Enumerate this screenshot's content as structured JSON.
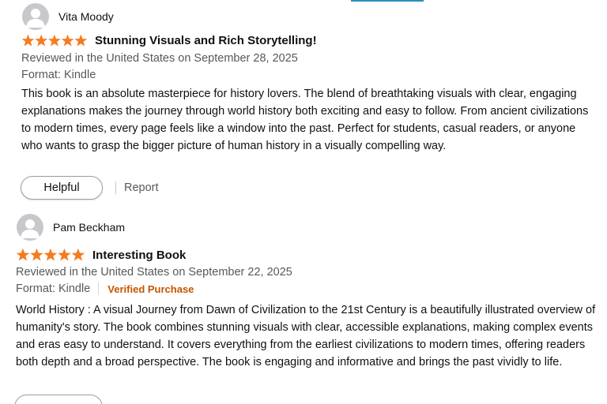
{
  "colors": {
    "star": "#f47b20",
    "verified": "#c45500",
    "meta_text": "#565959",
    "accent_bar": "#2a8fbd"
  },
  "reviews": [
    {
      "reviewer": "Vita Moody",
      "rating": 5,
      "title": "Stunning Visuals and Rich Storytelling!",
      "date_line": "Reviewed in the United States on September 28, 2025",
      "format": "Format: Kindle",
      "verified": "",
      "body": "This book is an absolute masterpiece for history lovers. The blend of breathtaking visuals with clear, engaging explanations makes the journey through world history both exciting and easy to follow. From ancient civilizations to modern times, every page feels like a window into the past. Perfect for students, casual readers, or anyone who wants to grasp the bigger picture of human history in a visually compelling way.",
      "helpful_label": "Helpful",
      "report_label": "Report"
    },
    {
      "reviewer": "Pam Beckham",
      "rating": 5,
      "title": "Interesting Book",
      "date_line": "Reviewed in the United States on September 22, 2025",
      "format": "Format: Kindle",
      "verified": "Verified Purchase",
      "body": "World History : A visual Journey from Dawn of Civilization to the 21st Century is a beautifully illustrated overview of humanity's story. The book combines stunning visuals with clear, accessible explanations, making complex events and eras easy to understand. It covers everything from the earliest civilizations to modern times, offering readers both depth and a broad perspective. The book is engaging and informative and brings the past vividly to life."
    }
  ]
}
